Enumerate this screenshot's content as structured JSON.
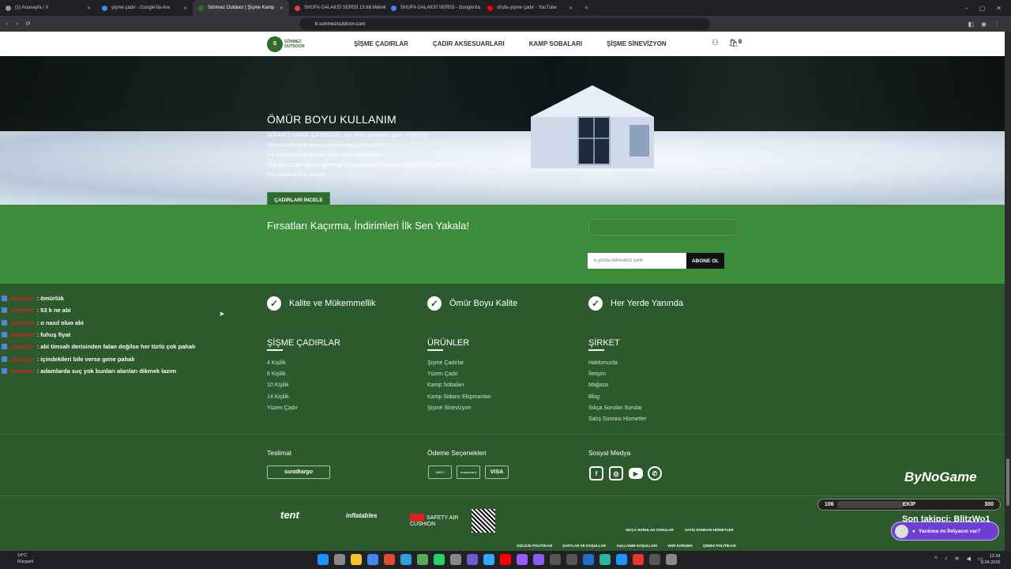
{
  "browser": {
    "tabs": [
      {
        "label": "(1) Anasayfa / X",
        "color": "#999999"
      },
      {
        "label": "şişme çadır - Google'da Ara",
        "color": "#4285f4"
      },
      {
        "label": "Sönmez Outdoor | Şişme Kamp",
        "color": "#2e6b2e"
      },
      {
        "label": "SHUFA GALAKSİ SERİSİ 13.68 Metrek",
        "color": "#e94235"
      },
      {
        "label": "SHUFA GALAKSİ SERİSİ - Google'da",
        "color": "#4285f4"
      },
      {
        "label": "shufa şişme çadır - YouTube",
        "color": "#ff0000"
      }
    ],
    "new_tab": "+",
    "url": "tr.sonmezoutdoor.com",
    "window_buttons": [
      "–",
      "▢",
      "✕"
    ]
  },
  "site": {
    "logo": {
      "line1": "SÖNMEZ",
      "line2": "OUTDOOR"
    },
    "nav": [
      "ŞİŞME ÇADIRLAR",
      "ÇADIR AKSESUARLARI",
      "KAMP SOBALARI",
      "ŞİŞME SİNEVİZYON"
    ],
    "cart_count": "0",
    "hero": {
      "title": "ÖMÜR BOYU KULLANIM",
      "lines": [
        "SÖNMEZ ŞİŞME ÇADIRLARI, ağır iklim şartlarına göre üretilmiştir.",
        "Yüksek teknoloji içeren malzemeler kullanıyoruz.",
        "En zorlu ortamlarda bile uzun süreli performans.",
        "Ürünlerimizden birinin gerektiği gibi performans göstermediğini fark ederseniz",
        "söz, sadece bize ulaşın!"
      ],
      "cta": "ÇADIRLARI İNCELE"
    },
    "promo": {
      "title": "Fırsatları Kaçırma, İndirimleri İlk Sen Yakala!",
      "email_placeholder": "E-posta Adresinizi Girin",
      "subscribe": "ABONE OL"
    },
    "features": [
      "Kalite ve Mükemmellik",
      "Ömür Boyu Kalite",
      "Her Yerde Yanında"
    ],
    "columns": [
      {
        "title": "ŞİŞME ÇADIRLAR",
        "items": [
          "4 Kişilik",
          "6 Kişilik",
          "10 Kişilik",
          "14 Kişilik",
          "Yüzen Çadır"
        ]
      },
      {
        "title": "ÜRÜNLER",
        "items": [
          "Şişme Çadırlar",
          "Yüzen Çadır",
          "Kamp Sobaları",
          "Kamp Sobası Ekipmanları",
          "Şişme Sinevizyon"
        ]
      },
      {
        "title": "ŞİRKET",
        "items": [
          "Hakkımızda",
          "İletişim",
          "Mağaza",
          "Blog",
          "Sıkça Sorulan Sorular",
          "Satış Sonrası Hizmetler"
        ]
      }
    ],
    "delivery": {
      "title": "Teslimat",
      "brand": "suratkargo"
    },
    "payment": {
      "title": "Ödeme Seçenekleri",
      "cards": [
        "AMEX",
        "mastercard",
        "VISA"
      ]
    },
    "social": {
      "title": "Sosyal Medya",
      "icons": [
        "facebook-icon",
        "instagram-icon",
        "youtube-icon",
        "whatsapp-icon"
      ]
    },
    "bottom_logos": [
      "tent",
      "inflatables",
      "SAFETY AIR CUSHION"
    ],
    "policies_row1": [
      "GİZLİLİK POLİTİKASI",
      "ŞARTLAR VE KOŞULLAR",
      "KULLANIM KOŞULLARI",
      "VERİ KORUMA",
      "ÇEREZ POLİTİKASI"
    ],
    "policies_row2": [
      "SIKÇA SORULAN SORULAR",
      "SATIŞ SONRASI HİZMETLER"
    ]
  },
  "stream": {
    "chat": [
      {
        "user": "streamer",
        "text": ": ömürlük"
      },
      {
        "user": "streamer",
        "text": ": 53 k ne abi"
      },
      {
        "user": "streamer",
        "text": ": o nasıl oluo abi"
      },
      {
        "user": "streamer",
        "text": ": fuhuş fiyat"
      },
      {
        "user": "streamer",
        "text": ": abi timsah derisinden falan değilse her türlü çok pahalı"
      },
      {
        "user": "streamer",
        "text": ": içindekileri bile verse gene pahalı"
      },
      {
        "user": "streamer",
        "text": ": adamlarda suç yok bunları alanları dikmek lazım"
      }
    ],
    "brand": "ByNoGame",
    "bar": {
      "left": "106",
      "label": "EKİP",
      "right": "300",
      "fill_percent": 35
    },
    "follower": "Son takipçi: BlitzWo1",
    "help": "Yardıma mı İhtiyacın var?"
  },
  "taskbar": {
    "temp": "14°C",
    "weather": "Rüzgarlı",
    "time": "12:34",
    "date": "8.04.2026"
  }
}
